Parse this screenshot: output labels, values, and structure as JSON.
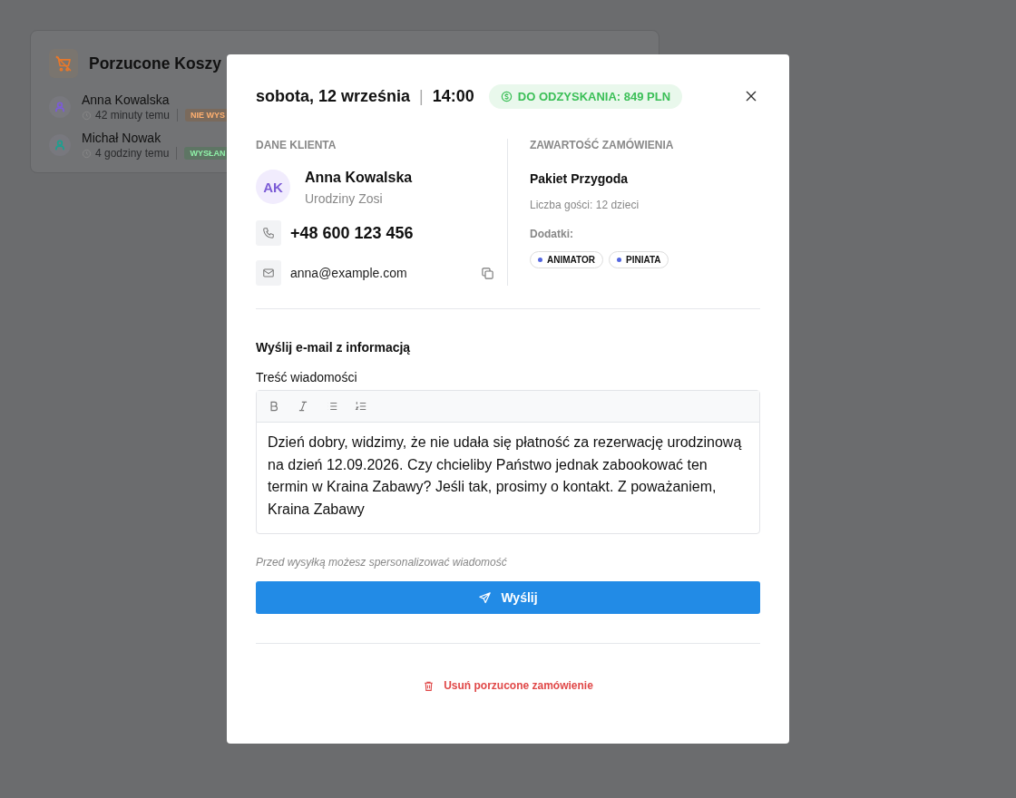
{
  "background_card": {
    "title": "Porzucone Koszy",
    "items": [
      {
        "name": "Anna Kowalska",
        "time": "42 minuty temu",
        "status": "NIE WYS",
        "kind": "pending",
        "color": "#7c5cd6"
      },
      {
        "name": "Michał Nowak",
        "time": "4 godziny temu",
        "status": "WYSŁAN",
        "kind": "sent",
        "color": "#1f9e8f"
      }
    ]
  },
  "modal": {
    "date": "sobota, 12 września",
    "separator": "|",
    "time": "14:00",
    "badge": "DO ODZYSKANIA: 849 PLN",
    "client": {
      "heading": "DANE KLIENTA",
      "initials": "AK",
      "name": "Anna Kowalska",
      "occasion": "Urodziny Zosi",
      "phone": "+48 600 123 456",
      "email": "anna@example.com"
    },
    "order": {
      "heading": "ZAWARTOŚĆ ZAMÓWIENIA",
      "package": "Pakiet Przygoda",
      "guests": "Liczba gości: 12 dzieci",
      "addons_label": "Dodatki:",
      "addons": [
        "ANIMATOR",
        "PINIATA"
      ]
    },
    "email": {
      "heading": "Wyślij e-mail z informacją",
      "label": "Treść wiadomości",
      "body": "Dzień dobry, widzimy, że nie udała się płatność za rezerwację urodzinową na dzień 12.09.2026. Czy chcieliby Państwo jednak zabookować ten termin w Kraina Zabawy? Jeśli tak, prosimy o kontakt. Z poważaniem, Kraina Zabawy",
      "hint": "Przed wysyłką możesz spersonalizować wiadomość",
      "send": "Wyślij"
    },
    "delete": "Usuń porzucone zamówienie"
  }
}
